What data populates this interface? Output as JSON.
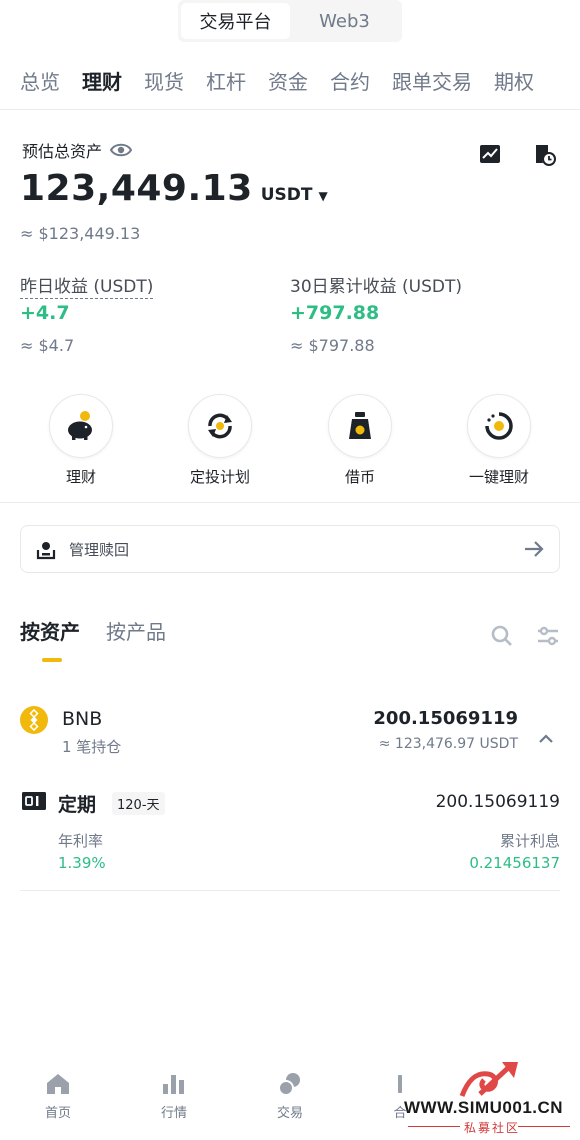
{
  "segment": {
    "tabs": [
      {
        "label": "交易平台"
      },
      {
        "label": "Web3"
      }
    ]
  },
  "nav": {
    "items": [
      {
        "label": "总览"
      },
      {
        "label": "理财"
      },
      {
        "label": "现货"
      },
      {
        "label": "杠杆"
      },
      {
        "label": "资金"
      },
      {
        "label": "合约"
      },
      {
        "label": "跟单交易"
      },
      {
        "label": "期权"
      }
    ]
  },
  "summary": {
    "label": "预估总资产",
    "total": "123,449.13",
    "unit": "USDT",
    "total_approx": "≈ $123,449.13",
    "yesterday_label": "昨日收益 (USDT)",
    "yesterday_value": "+4.7",
    "yesterday_approx": "≈ $4.7",
    "month_label": "30日累计收益 (USDT)",
    "month_value": "+797.88",
    "month_approx": "≈ $797.88"
  },
  "quick_actions": [
    {
      "label": "理财"
    },
    {
      "label": "定投计划"
    },
    {
      "label": "借币"
    },
    {
      "label": "一键理财"
    }
  ],
  "redeem": {
    "label": "管理赎回"
  },
  "asset_tabs": [
    {
      "label": "按资产"
    },
    {
      "label": "按产品"
    }
  ],
  "holding": {
    "coin": "BNB",
    "positions": "1 笔持仓",
    "amount": "200.15069119",
    "usd": "≈ 123,476.97 USDT",
    "product": {
      "title": "定期",
      "term": "120-天",
      "amount": "200.15069119",
      "apr_label": "年利率",
      "apr_value": "1.39%",
      "interest_label": "累计利息",
      "interest_value": "0.21456137"
    }
  },
  "bottom_nav": [
    {
      "label": "首页"
    },
    {
      "label": "行情"
    },
    {
      "label": "交易"
    },
    {
      "label": "合"
    }
  ],
  "watermark": {
    "text": "WWW.SIMU001.CN",
    "sub": "私募社区"
  },
  "colors": {
    "accent": "#f0b90b",
    "up": "#2ebd85",
    "text": "#1e2329",
    "muted": "#707a8a"
  }
}
